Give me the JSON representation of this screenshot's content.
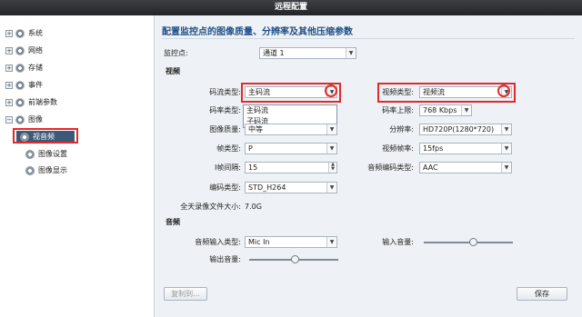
{
  "window": {
    "title": "远程配置"
  },
  "sidebar": {
    "items": [
      {
        "label": "系统",
        "expander": "+"
      },
      {
        "label": "网络",
        "expander": "+"
      },
      {
        "label": "存储",
        "expander": "+"
      },
      {
        "label": "事件",
        "expander": "+"
      },
      {
        "label": "前端参数",
        "expander": "+"
      },
      {
        "label": "图像",
        "expander": "−"
      }
    ],
    "children": [
      {
        "label": "视音频"
      },
      {
        "label": "图像设置"
      },
      {
        "label": "图像显示"
      }
    ]
  },
  "main": {
    "header": "配置监控点的图像质量、分辨率及其他压缩参数",
    "monitor_point": {
      "label": "监控点:",
      "value": "通道 1"
    },
    "video_section": "视频",
    "stream_type": {
      "label": "码流类型:",
      "value": "主码流",
      "options": [
        "主码流",
        "子码流"
      ]
    },
    "bitrate_type": {
      "label": "码率类型:",
      "value": ""
    },
    "image_quality": {
      "label": "图像质量:",
      "value": "中等"
    },
    "frame_type": {
      "label": "帧类型:",
      "value": "P"
    },
    "i_frame_interval": {
      "label": "I帧间隔:",
      "value": "15"
    },
    "encoding_type": {
      "label": "编码类型:",
      "value": "STD_H264"
    },
    "file_size": {
      "label": "全天录像文件大小:",
      "value": "7.0G"
    },
    "video_type": {
      "label": "视频类型:",
      "value": "视频流"
    },
    "bitrate_limit": {
      "label": "码率上限:",
      "value": "768 Kbps"
    },
    "resolution": {
      "label": "分辨率:",
      "value": "HD720P(1280*720)"
    },
    "frame_rate": {
      "label": "视频帧率:",
      "value": "15fps"
    },
    "audio_encoding": {
      "label": "音频编码类型:",
      "value": "AAC"
    },
    "audio_section": "音频",
    "audio_input_type": {
      "label": "音频输入类型:",
      "value": "Mic In"
    },
    "input_volume": {
      "label": "输入音量:",
      "level": 0.56
    },
    "output_volume": {
      "label": "输出音量:",
      "level": 0.52
    },
    "copy_button": "复制到...",
    "save_button": "保存"
  }
}
